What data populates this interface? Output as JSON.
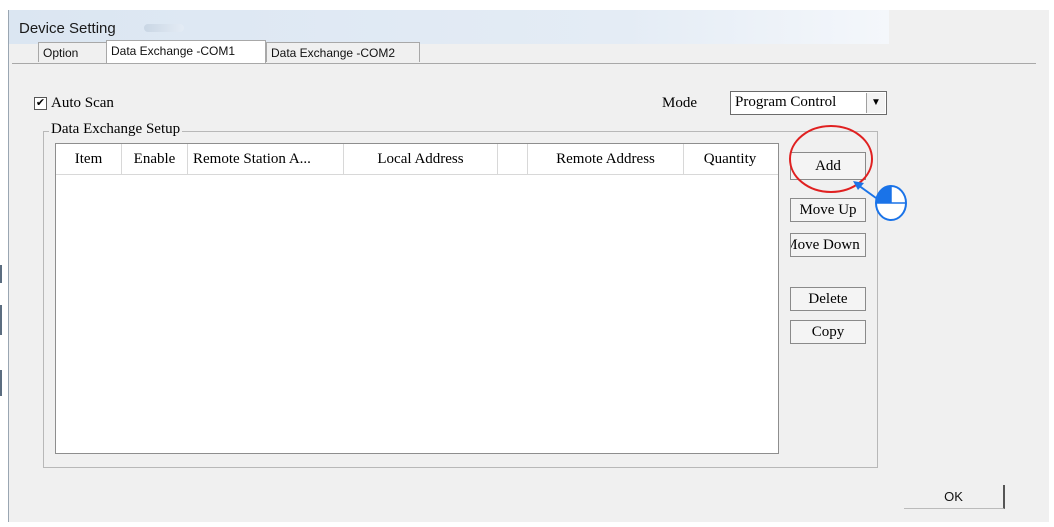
{
  "window": {
    "title": "Device Setting"
  },
  "tabs": [
    {
      "label": "Option"
    },
    {
      "label": "Data Exchange -COM1"
    },
    {
      "label": "Data Exchange -COM2"
    }
  ],
  "auto_scan": {
    "label": "Auto Scan",
    "checked": true,
    "check_glyph": "✔"
  },
  "mode": {
    "label": "Mode",
    "value": "Program Control",
    "arrow_glyph": "▼"
  },
  "group": {
    "title": "Data Exchange Setup",
    "columns": [
      "Item",
      "Enable",
      "Remote Station A...",
      "Local Address",
      "",
      "Remote Address",
      "Quantity"
    ],
    "rows": []
  },
  "buttons": {
    "add": "Add",
    "move_up": "Move Up",
    "move_down": "Move Down",
    "delete": "Delete",
    "copy": "Copy",
    "ok": "OK"
  },
  "annotation": {
    "highlight_color": "#e02020",
    "pointer_color": "#1a73e8",
    "icon": "mouse-click-icon"
  }
}
